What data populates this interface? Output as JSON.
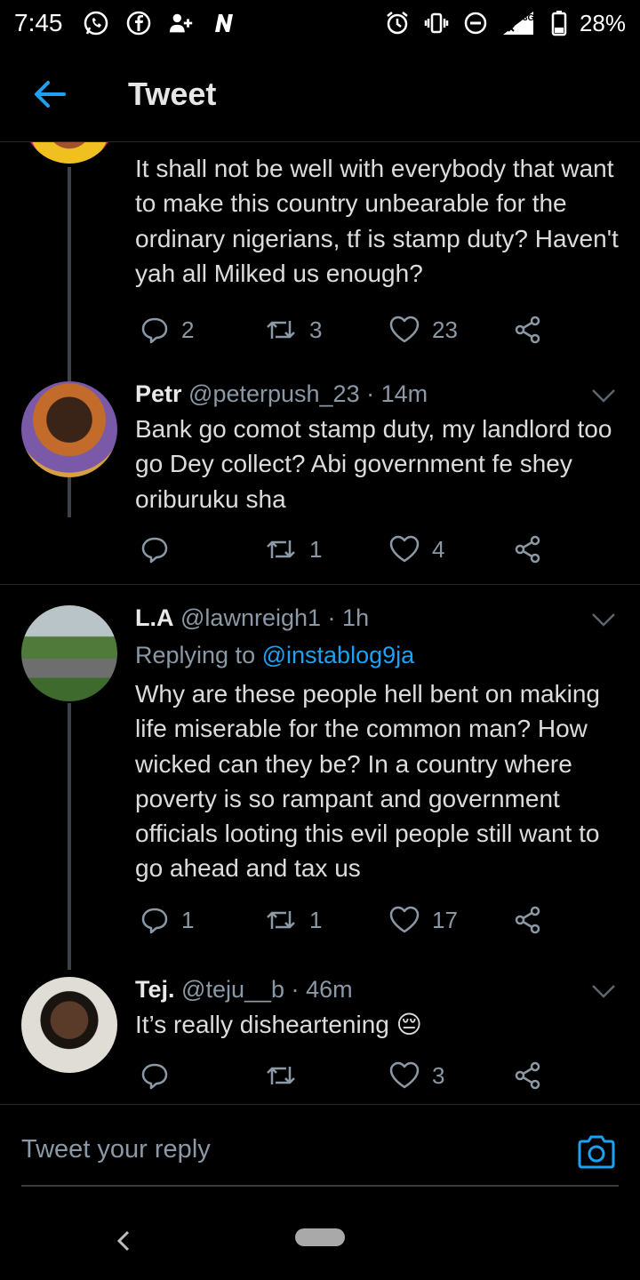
{
  "status_bar": {
    "time": "7:45",
    "battery": "28%",
    "network": "3G",
    "left_icons": [
      "whatsapp-icon",
      "facebook-icon",
      "add-friend-icon",
      "n-app-icon"
    ],
    "right_icons": [
      "alarm-icon",
      "vibrate-icon",
      "do-not-disturb-icon",
      "signal-icon",
      "battery-icon"
    ]
  },
  "header": {
    "title": "Tweet",
    "accent": "#1da1f2"
  },
  "tweets": [
    {
      "text": "It shall not be well with everybody that want to make this country unbearable for the ordinary nigerians, tf is stamp duty? Haven't yah all Milked us enough?",
      "replies": "2",
      "retweets": "3",
      "likes": "23"
    },
    {
      "name": "Petr",
      "handle": "@peterpush_23",
      "time": "14m",
      "text": "Bank go comot stamp duty, my landlord too go Dey collect? Abi government fe shey oriburuku sha",
      "replies": "",
      "retweets": "1",
      "likes": "4"
    },
    {
      "name": "L.A",
      "handle": "@lawnreigh1",
      "time": "1h",
      "replying_label": "Replying to",
      "replying_to": "@instablog9ja",
      "text": "Why are these people hell bent on making life miserable for the common man? How wicked can they be? In a country where poverty is so rampant and government officials looting this evil people still want to go ahead and tax us",
      "replies": "1",
      "retweets": "1",
      "likes": "17"
    },
    {
      "name": "Tej.",
      "handle": "@teju__b",
      "time": "46m",
      "text": "It’s really disheartening 😔",
      "replies": "",
      "retweets": "",
      "likes": "3"
    }
  ],
  "reply_bar": {
    "placeholder": "Tweet your reply"
  },
  "colors": {
    "background": "#000000",
    "text": "#dcdcdc",
    "muted": "#8b98a5",
    "link": "#1da1f2",
    "divider": "#2a2a2a"
  }
}
